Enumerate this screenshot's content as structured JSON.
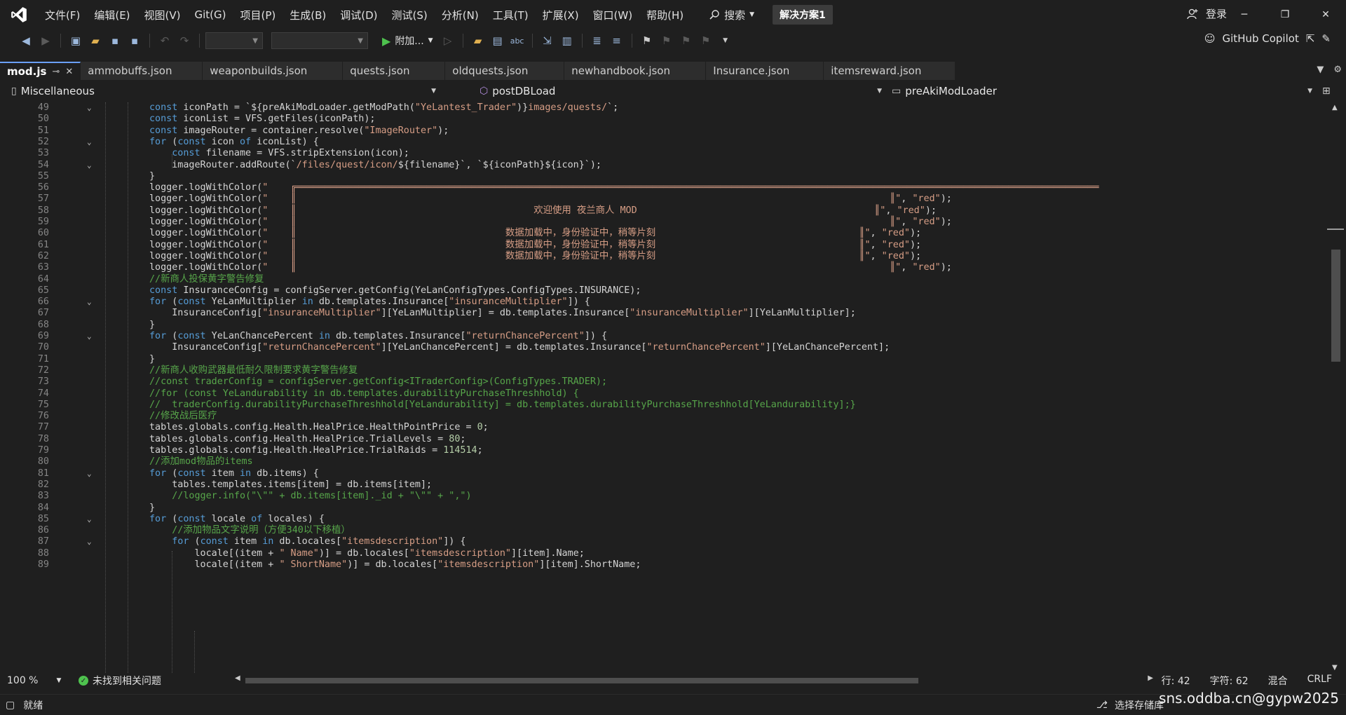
{
  "menubar": {
    "items": [
      "文件(F)",
      "编辑(E)",
      "视图(V)",
      "Git(G)",
      "项目(P)",
      "生成(B)",
      "调试(D)",
      "测试(S)",
      "分析(N)",
      "工具(T)",
      "扩展(X)",
      "窗口(W)",
      "帮助(H)"
    ],
    "search_label": "搜索",
    "solution_badge": "解决方案1",
    "login_label": "登录"
  },
  "toolbar": {
    "attach_label": "附加...",
    "copilot_label": "GitHub Copilot"
  },
  "tabs": [
    {
      "label": "mod.js",
      "active": true
    },
    {
      "label": "ammobuffs.json",
      "active": false
    },
    {
      "label": "weaponbuilds.json",
      "active": false
    },
    {
      "label": "quests.json",
      "active": false
    },
    {
      "label": "oldquests.json",
      "active": false
    },
    {
      "label": "newhandbook.json",
      "active": false
    },
    {
      "label": "Insurance.json",
      "active": false
    },
    {
      "label": "itemsreward.json",
      "active": false
    }
  ],
  "navbar": {
    "project": "Miscellaneous",
    "member": "postDBLoad",
    "scope": "preAkiModLoader"
  },
  "editor": {
    "lines": [
      {
        "n": 49,
        "fold": true,
        "html": "<span class=\"kw\">const</span> iconPath = `${preAkiModLoader.getModPath(<span class=\"str\">\"YeLantest_Trader\"</span>)}<span class=\"str\">images/quests/</span>`;"
      },
      {
        "n": 50,
        "fold": false,
        "html": "<span class=\"kw\">const</span> iconList = VFS.getFiles(iconPath);"
      },
      {
        "n": 51,
        "fold": false,
        "html": "<span class=\"kw\">const</span> imageRouter = container.resolve(<span class=\"str\">\"ImageRouter\"</span>);"
      },
      {
        "n": 52,
        "fold": true,
        "html": "<span class=\"cf\">for</span> (<span class=\"kw\">const</span> icon <span class=\"kw\">of</span> iconList) {"
      },
      {
        "n": 53,
        "fold": false,
        "html": "    <span class=\"kw\">const</span> filename = VFS.stripExtension(icon);"
      },
      {
        "n": 54,
        "fold": true,
        "html": "    imageRouter.addRoute(`<span class=\"str\">/files/quest/icon/</span>${filename}`, `${iconPath}${icon}`);"
      },
      {
        "n": 55,
        "fold": false,
        "html": "}"
      },
      {
        "n": 56,
        "fold": false,
        "html": "logger.logWithColor(<span class=\"str\">\"    ╔══════════════════════════════════════════════════════════════════════════════════════════════════════════════════════════════════════════════</span>"
      },
      {
        "n": 57,
        "fold": false,
        "html": "logger.logWithColor(<span class=\"str\">\"    ║                                                                                                         ║\"</span>, <span class=\"str\">\"red\"</span>);"
      },
      {
        "n": 58,
        "fold": false,
        "html": "logger.logWithColor(<span class=\"str\">\"    ║                                          欢迎使用 夜兰商人 MOD                                          ║\"</span>, <span class=\"str\">\"red\"</span>);"
      },
      {
        "n": 59,
        "fold": false,
        "html": "logger.logWithColor(<span class=\"str\">\"    ║                                                                                                         ║\"</span>, <span class=\"str\">\"red\"</span>);"
      },
      {
        "n": 60,
        "fold": false,
        "html": "logger.logWithColor(<span class=\"str\">\"    ║                                     数据加载中，身份验证中，稍等片刻                                    ║\"</span>, <span class=\"str\">\"red\"</span>);"
      },
      {
        "n": 61,
        "fold": false,
        "html": "logger.logWithColor(<span class=\"str\">\"    ║                                     数据加载中，身份验证中，稍等片刻                                    ║\"</span>, <span class=\"str\">\"red\"</span>);"
      },
      {
        "n": 62,
        "fold": false,
        "html": "logger.logWithColor(<span class=\"str\">\"    ║                                     数据加载中，身份验证中，稍等片刻                                    ║\"</span>, <span class=\"str\">\"red\"</span>);"
      },
      {
        "n": 63,
        "fold": false,
        "html": "logger.logWithColor(<span class=\"str\">\"    ║                                                                                                         ║\"</span>, <span class=\"str\">\"red\"</span>);"
      },
      {
        "n": 64,
        "fold": false,
        "html": "<span class=\"cm\">//新商人投保黄字警告修复</span>"
      },
      {
        "n": 65,
        "fold": false,
        "html": "<span class=\"kw\">const</span> InsuranceConfig = configServer.getConfig(YeLanConfigTypes.ConfigTypes.INSURANCE);"
      },
      {
        "n": 66,
        "fold": true,
        "html": "<span class=\"cf\">for</span> (<span class=\"kw\">const</span> YeLanMultiplier <span class=\"kw\">in</span> db.templates.Insurance[<span class=\"str\">\"insuranceMultiplier\"</span>]) {"
      },
      {
        "n": 67,
        "fold": false,
        "html": "    InsuranceConfig[<span class=\"str\">\"insuranceMultiplier\"</span>][YeLanMultiplier] = db.templates.Insurance[<span class=\"str\">\"insuranceMultiplier\"</span>][YeLanMultiplier];"
      },
      {
        "n": 68,
        "fold": false,
        "html": "}"
      },
      {
        "n": 69,
        "fold": true,
        "html": "<span class=\"cf\">for</span> (<span class=\"kw\">const</span> YeLanChancePercent <span class=\"kw\">in</span> db.templates.Insurance[<span class=\"str\">\"returnChancePercent\"</span>]) {"
      },
      {
        "n": 70,
        "fold": false,
        "html": "    InsuranceConfig[<span class=\"str\">\"returnChancePercent\"</span>][YeLanChancePercent] = db.templates.Insurance[<span class=\"str\">\"returnChancePercent\"</span>][YeLanChancePercent];"
      },
      {
        "n": 71,
        "fold": false,
        "html": "}"
      },
      {
        "n": 72,
        "fold": false,
        "html": "<span class=\"cm\">//新商人收购武器最低耐久限制要求黄字警告修复</span>"
      },
      {
        "n": 73,
        "fold": false,
        "html": "<span class=\"cm\">//const traderConfig = configServer.getConfig&lt;ITraderConfig&gt;(ConfigTypes.TRADER);</span>"
      },
      {
        "n": 74,
        "fold": false,
        "html": "<span class=\"cm\">//for (const YeLandurability in db.templates.durabilityPurchaseThreshhold) {</span>"
      },
      {
        "n": 75,
        "fold": false,
        "html": "<span class=\"cm\">//  traderConfig.durabilityPurchaseThreshhold[YeLandurability] = db.templates.durabilityPurchaseThreshhold[YeLandurability];}</span>"
      },
      {
        "n": 76,
        "fold": false,
        "html": "<span class=\"cm\">//修改战后医疗</span>"
      },
      {
        "n": 77,
        "fold": false,
        "html": "tables.globals.config.Health.HealPrice.HealthPointPrice = <span class=\"num\">0</span>;"
      },
      {
        "n": 78,
        "fold": false,
        "html": "tables.globals.config.Health.HealPrice.TrialLevels = <span class=\"num\">80</span>;"
      },
      {
        "n": 79,
        "fold": false,
        "html": "tables.globals.config.Health.HealPrice.TrialRaids = <span class=\"num\">114514</span>;"
      },
      {
        "n": 80,
        "fold": false,
        "html": "<span class=\"cm\">//添加mod物品的items</span>"
      },
      {
        "n": 81,
        "fold": true,
        "html": "<span class=\"cf\">for</span> (<span class=\"kw\">const</span> item <span class=\"kw\">in</span> db.items) {"
      },
      {
        "n": 82,
        "fold": false,
        "html": "    tables.templates.items[item] = db.items[item];"
      },
      {
        "n": 83,
        "fold": false,
        "html": "    <span class=\"cm\">//logger.info(\"\\\"\" + db.items[item]._id + \"\\\"\" + \",\")</span>"
      },
      {
        "n": 84,
        "fold": false,
        "html": "}"
      },
      {
        "n": 85,
        "fold": true,
        "html": "<span class=\"cf\">for</span> (<span class=\"kw\">const</span> locale <span class=\"kw\">of</span> locales) {"
      },
      {
        "n": 86,
        "fold": false,
        "html": "    <span class=\"cm\">//添加物品文字说明（方便340以下移植）</span>"
      },
      {
        "n": 87,
        "fold": true,
        "html": "    <span class=\"cf\">for</span> (<span class=\"kw\">const</span> item <span class=\"kw\">in</span> db.locales[<span class=\"str\">\"itemsdescription\"</span>]) {"
      },
      {
        "n": 88,
        "fold": false,
        "html": "        locale[(item + <span class=\"str\">\" Name\"</span>)] = db.locales[<span class=\"str\">\"itemsdescription\"</span>][item].Name;"
      },
      {
        "n": 89,
        "fold": false,
        "html": "        locale[(item + <span class=\"str\">\" ShortName\"</span>)] = db.locales[<span class=\"str\">\"itemsdescription\"</span>][item].ShortName;"
      }
    ]
  },
  "editor_status": {
    "zoom": "100 %",
    "issues": "未找到相关问题",
    "line": "行: 42",
    "char": "字符: 62",
    "indent": "混合",
    "eol": "CRLF"
  },
  "statusbar": {
    "ready": "就绪",
    "source_control": "选择存储库"
  },
  "watermark": "sns.oddba.cn@gypw2025"
}
